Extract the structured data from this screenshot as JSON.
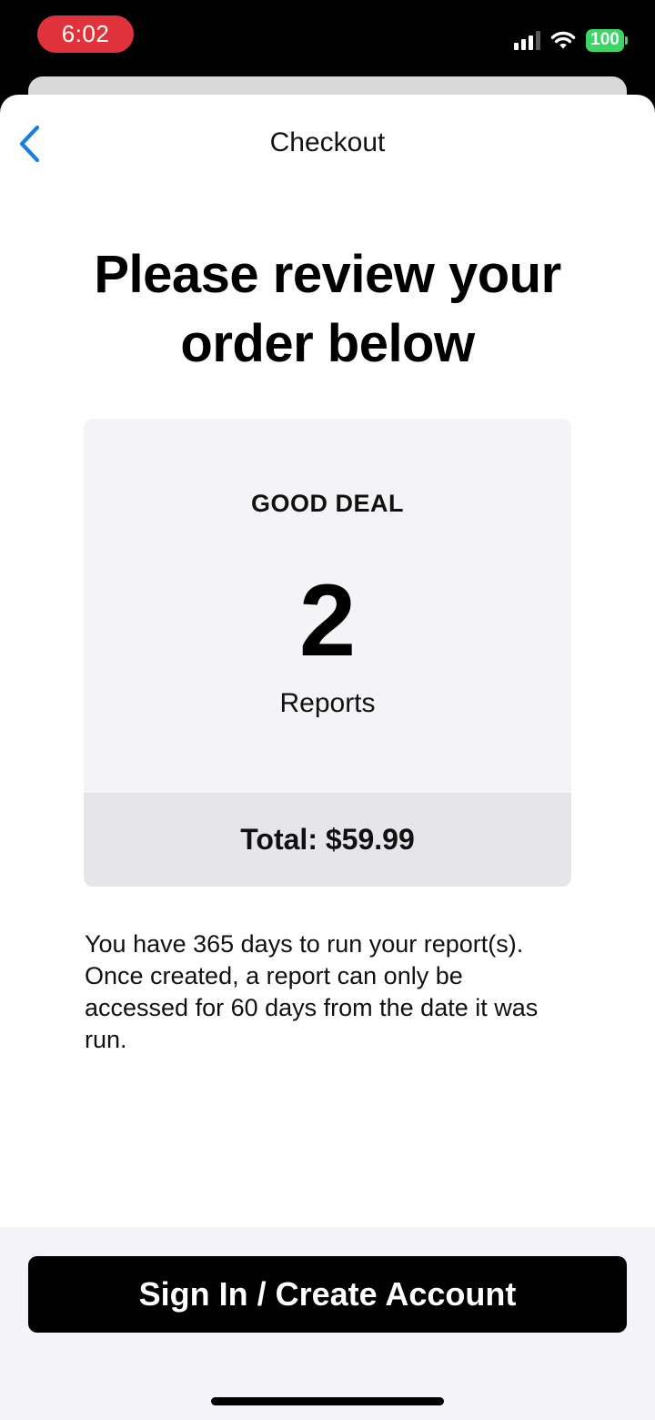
{
  "status_bar": {
    "time": "6:02",
    "battery_level": "100",
    "icons": [
      "signal-icon",
      "wifi-icon",
      "battery-icon"
    ]
  },
  "nav": {
    "title": "Checkout",
    "back_icon": "chevron-left-icon"
  },
  "headline": "Please review your order below",
  "plan": {
    "name": "GOOD DEAL",
    "count": "2",
    "unit": "Reports",
    "total": "Total: $59.99"
  },
  "terms": "You have 365 days to run your report(s). Once created, a report can only be accessed for 60 days from the date it was run.",
  "footer": {
    "primary_button": "Sign In / Create Account"
  },
  "colors": {
    "accent_blue": "#1a7ee0",
    "time_pill": "#e0323b",
    "battery": "#3ed467",
    "card_bg": "#f4f3f6",
    "total_bg": "#e6e5e9",
    "button_bg": "#000000"
  }
}
